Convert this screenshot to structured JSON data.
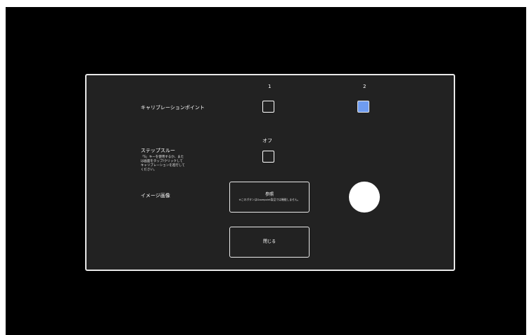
{
  "panel": {
    "calibration": {
      "label": "キャリブレーションポイント",
      "columns": [
        "1",
        "2"
      ],
      "options": [
        {
          "value": "1",
          "checked": false
        },
        {
          "value": "2",
          "checked": true
        }
      ]
    },
    "step_through": {
      "label": "ステップスルー",
      "hint": "「S」キーを使用するか、または画面をタップ/クリックしてキャリブレーションを進行してください。",
      "option_label": "オフ",
      "checked": false
    },
    "image": {
      "label": "イメージ画像",
      "browse_label": "参照",
      "browse_sub": "※このボタンはGazepoint製品では機能しません。"
    },
    "close_label": "閉じる"
  },
  "colors": {
    "panel_bg": "#222222",
    "screen_bg": "#000000",
    "accent": "#6f9cf0",
    "border": "#e8e8e8"
  }
}
